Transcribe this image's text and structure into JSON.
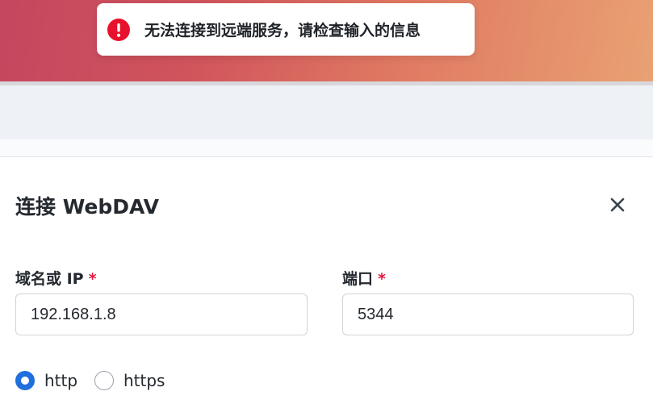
{
  "toast": {
    "icon": "exclamation-icon",
    "message": "无法连接到远端服务，请检查输入的信息",
    "color": "#e8112d"
  },
  "dialog": {
    "title": "连接 WebDAV",
    "close_icon": "close-icon",
    "fields": {
      "host": {
        "label": "域名或 IP",
        "required_mark": "*",
        "value": "192.168.1.8"
      },
      "port": {
        "label": "端口",
        "required_mark": "*",
        "value": "5344"
      }
    },
    "protocol": {
      "options": [
        {
          "label": "http",
          "checked": true
        },
        {
          "label": "https",
          "checked": false
        }
      ]
    }
  },
  "colors": {
    "accent": "#1f6fdc",
    "required": "#e5173f",
    "error": "#e8112d"
  }
}
